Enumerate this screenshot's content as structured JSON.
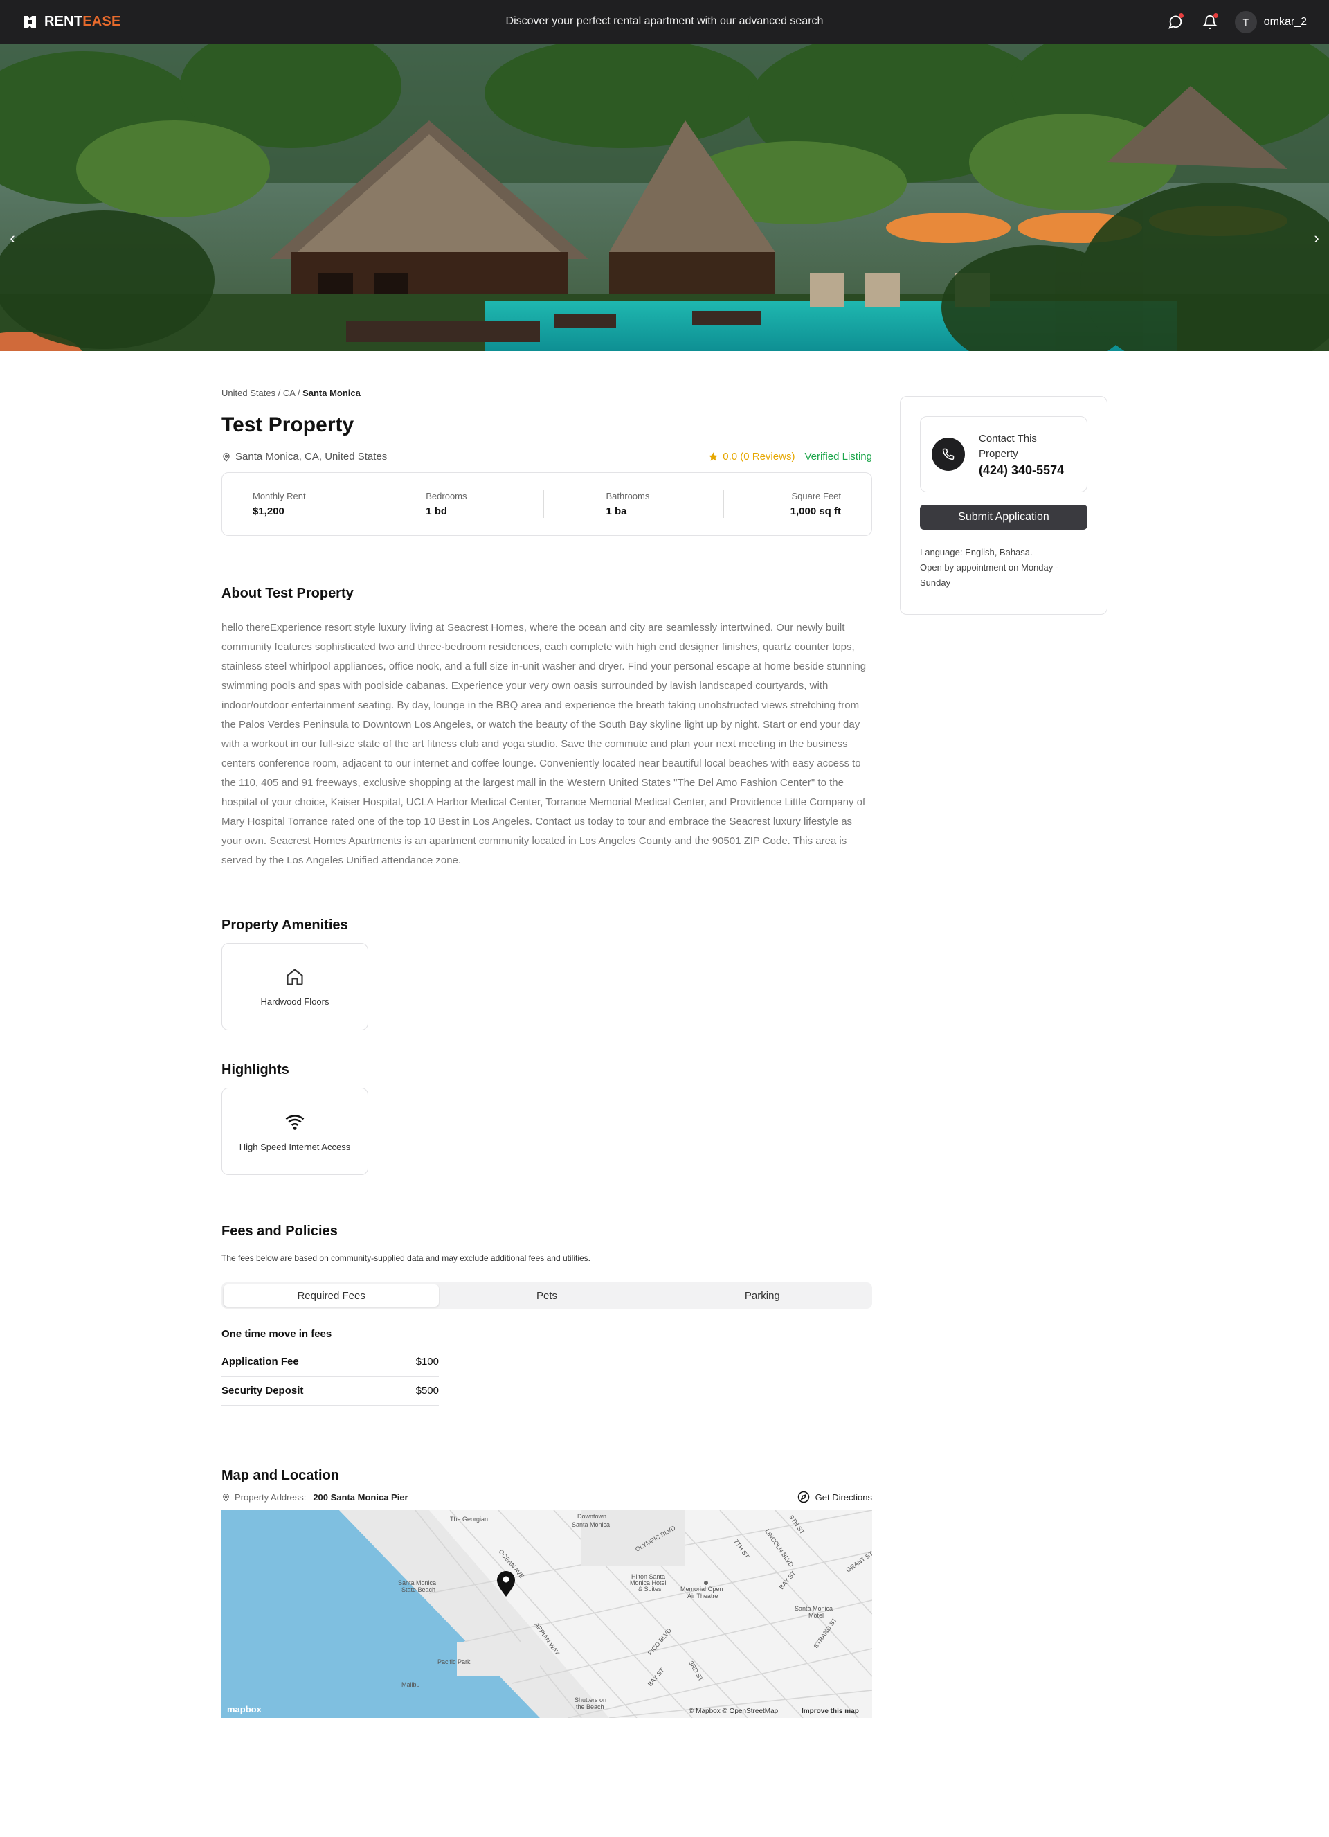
{
  "header": {
    "brand_main": "RENT",
    "brand_accent": "EASE",
    "tagline": "Discover your perfect rental apartment with our advanced search",
    "user_initial": "T",
    "username": "omkar_2"
  },
  "gallery": {
    "prev_label": "‹",
    "next_label": "›"
  },
  "breadcrumb": {
    "country": "United States",
    "state": "CA",
    "city": "Santa Monica",
    "separator": " / "
  },
  "property": {
    "title": "Test Property",
    "location": "Santa Monica, CA, United States",
    "rating": "0.0 (0 Reviews)",
    "verified": "Verified Listing"
  },
  "stats": [
    {
      "label": "Monthly Rent",
      "value": "$1,200"
    },
    {
      "label": "Bedrooms",
      "value": "1 bd"
    },
    {
      "label": "Bathrooms",
      "value": "1 ba"
    },
    {
      "label": "Square Feet",
      "value": "1,000 sq ft"
    }
  ],
  "about": {
    "heading": "About Test Property",
    "text": "hello thereExperience resort style luxury living at Seacrest Homes, where the ocean and city are seamlessly intertwined. Our newly built community features sophisticated two and three-bedroom residences, each complete with high end designer finishes, quartz counter tops, stainless steel whirlpool appliances, office nook, and a full size in-unit washer and dryer. Find your personal escape at home beside stunning swimming pools and spas with poolside cabanas. Experience your very own oasis surrounded by lavish landscaped courtyards, with indoor/outdoor entertainment seating. By day, lounge in the BBQ area and experience the breath taking unobstructed views stretching from the Palos Verdes Peninsula to Downtown Los Angeles, or watch the beauty of the South Bay skyline light up by night. Start or end your day with a workout in our full-size state of the art fitness club and yoga studio. Save the commute and plan your next meeting in the business centers conference room, adjacent to our internet and coffee lounge. Conveniently located near beautiful local beaches with easy access to the 110, 405 and 91 freeways, exclusive shopping at the largest mall in the Western United States \"The Del Amo Fashion Center\" to the hospital of your choice, Kaiser Hospital, UCLA Harbor Medical Center, Torrance Memorial Medical Center, and Providence Little Company of Mary Hospital Torrance rated one of the top 10 Best in Los Angeles. Contact us today to tour and embrace the Seacrest luxury lifestyle as your own. Seacrest Homes Apartments is an apartment community located in Los Angeles County and the 90501 ZIP Code. This area is served by the Los Angeles Unified attendance zone."
  },
  "amenities": {
    "heading": "Property Amenities",
    "items": [
      {
        "label": "Hardwood Floors",
        "icon": "home-icon"
      }
    ]
  },
  "highlights": {
    "heading": "Highlights",
    "items": [
      {
        "label": "High Speed Internet Access",
        "icon": "wifi-icon"
      }
    ]
  },
  "fees": {
    "heading": "Fees and Policies",
    "note": "The fees below are based on community-supplied data and may exclude additional fees and utilities.",
    "tabs": [
      "Required Fees",
      "Pets",
      "Parking"
    ],
    "active_tab": "Required Fees",
    "section_title": "One time move in fees",
    "rows": [
      {
        "name": "Application Fee",
        "amount": "$100"
      },
      {
        "name": "Security Deposit",
        "amount": "$500"
      }
    ]
  },
  "map": {
    "heading": "Map and Location",
    "address_label": "Property Address:",
    "address": "200 Santa Monica Pier",
    "directions": "Get Directions",
    "labels": {
      "georgian": "The Georgian",
      "downtown1": "Downtown",
      "downtown2": "Santa Monica",
      "olympic": "OLYMPIC BLVD",
      "ocean": "OCEAN AVE",
      "lincoln": "LINCOLN BLVD",
      "seventh": "7TH ST",
      "ninth": "9TH ST",
      "grant": "GRANT ST",
      "bay": "BAY ST",
      "hilton1": "Hilton Santa",
      "hilton2": "Monica Hotel",
      "hilton3": "& Suites",
      "mem1": "Memorial Open",
      "mem2": "Air Theatre",
      "beach1": "Santa Monica",
      "beach2": "State Beach",
      "appian": "APPIAN WAY",
      "pico": "PICO BLVD",
      "third": "3RD ST",
      "bayst2": "BAY ST",
      "motel1": "Santa Monica",
      "motel2": "Motel",
      "strand": "STRAND ST",
      "pacific": "Pacific Park",
      "malibu": "Malibu",
      "shutters1": "Shutters on",
      "shutters2": "the Beach",
      "mapbox": "mapbox",
      "credits": "© Mapbox © OpenStreetMap",
      "improve": "Improve this map"
    }
  },
  "contact": {
    "title": "Contact This Property",
    "phone": "(424) 340-5574",
    "submit": "Submit Application",
    "language": "Language: English, Bahasa.",
    "hours": "Open by appointment on Monday - Sunday"
  },
  "colors": {
    "topbar": "#1f1f21",
    "accent": "#e76a2c",
    "verified": "#1ca54a",
    "star": "#e6a700",
    "button": "#3a3a3f",
    "water": "#7fbfe0"
  }
}
